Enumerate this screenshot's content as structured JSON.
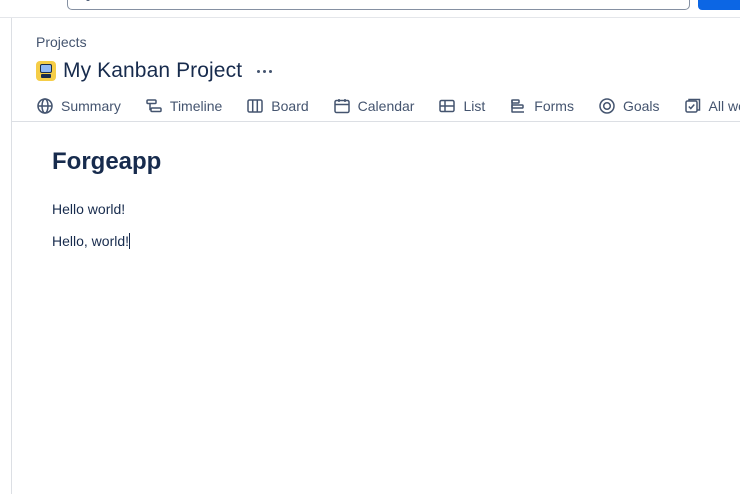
{
  "breadcrumb": {
    "label": "Projects"
  },
  "project": {
    "title": "My Kanban Project"
  },
  "tabs": [
    {
      "label": "Summary",
      "icon": "globe-icon"
    },
    {
      "label": "Timeline",
      "icon": "timeline-icon"
    },
    {
      "label": "Board",
      "icon": "board-icon"
    },
    {
      "label": "Calendar",
      "icon": "calendar-icon"
    },
    {
      "label": "List",
      "icon": "list-icon"
    },
    {
      "label": "Forms",
      "icon": "forms-icon"
    },
    {
      "label": "Goals",
      "icon": "goals-icon"
    },
    {
      "label": "All work",
      "icon": "all-work-icon"
    }
  ],
  "content": {
    "heading": "Forgeapp",
    "paragraphs": [
      "Hello world!",
      "Hello, world!"
    ]
  },
  "colors": {
    "accent": "#0c66e4",
    "text": "#172b4d",
    "subtle_text": "#44546f",
    "avatar": "#f5cd47"
  }
}
